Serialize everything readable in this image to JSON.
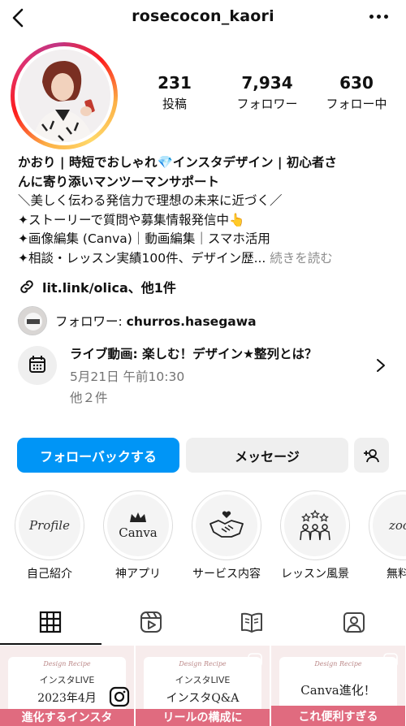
{
  "header": {
    "username": "rosecocon_kaori"
  },
  "stats": [
    {
      "count": "231",
      "label": "投稿"
    },
    {
      "count": "7,934",
      "label": "フォロワー"
    },
    {
      "count": "630",
      "label": "フォロー中"
    }
  ],
  "bio": {
    "title_line1": "かおり | 時短でおしゃれ💎インスタデザイン | 初心者さ",
    "title_line2": "んに寄り添いマンツーマンサポート",
    "line3": "＼美しく伝わる発信力で理想の未来に近づく／",
    "line4": "✦ストーリーで質問や募集情報発信中👆",
    "line5": "✦画像編集 (Canva)｜動画編集｜スマホ活用",
    "line6": "✦相談・レッスン実績100件、デザイン歴...",
    "more": " 続きを読む"
  },
  "link": {
    "text": "lit.link/olica、他1件"
  },
  "followed_by": {
    "prefix": "フォロワー: ",
    "name": "churros.hasegawa"
  },
  "event": {
    "title": "ライブ動画: 楽しむ！デザイン★整列とは？",
    "time": "5月21日 午前10:30",
    "more": "他２件"
  },
  "buttons": {
    "follow_back": "フォローバックする",
    "message": "メッセージ"
  },
  "highlights": [
    {
      "label": "自己紹介",
      "cover_text": "Profile"
    },
    {
      "label": "神アプリ",
      "cover_text": "Canva"
    },
    {
      "label": "サービス内容",
      "cover_text": ""
    },
    {
      "label": "レッスン風景",
      "cover_text": ""
    },
    {
      "label": "無料",
      "cover_text": "zoo"
    }
  ],
  "tabs": [
    "grid-icon",
    "reels-icon",
    "guides-icon",
    "tagged-icon"
  ],
  "posts": [
    {
      "recipe": "Design Recipe",
      "tag": "インスタLIVE",
      "big": "2023年4月",
      "pink": "進化するインスタ"
    },
    {
      "recipe": "Design Recipe",
      "tag": "インスタLIVE",
      "big": "インスタQ&A",
      "pink": "リールの構成に"
    },
    {
      "recipe": "Design Recipe",
      "tag": "",
      "big": "Canva進化！",
      "pink": "これ便利すぎる"
    }
  ],
  "colors": {
    "accent": "#0095f6",
    "muted": "#737373",
    "story_ring": "#e1306c"
  }
}
